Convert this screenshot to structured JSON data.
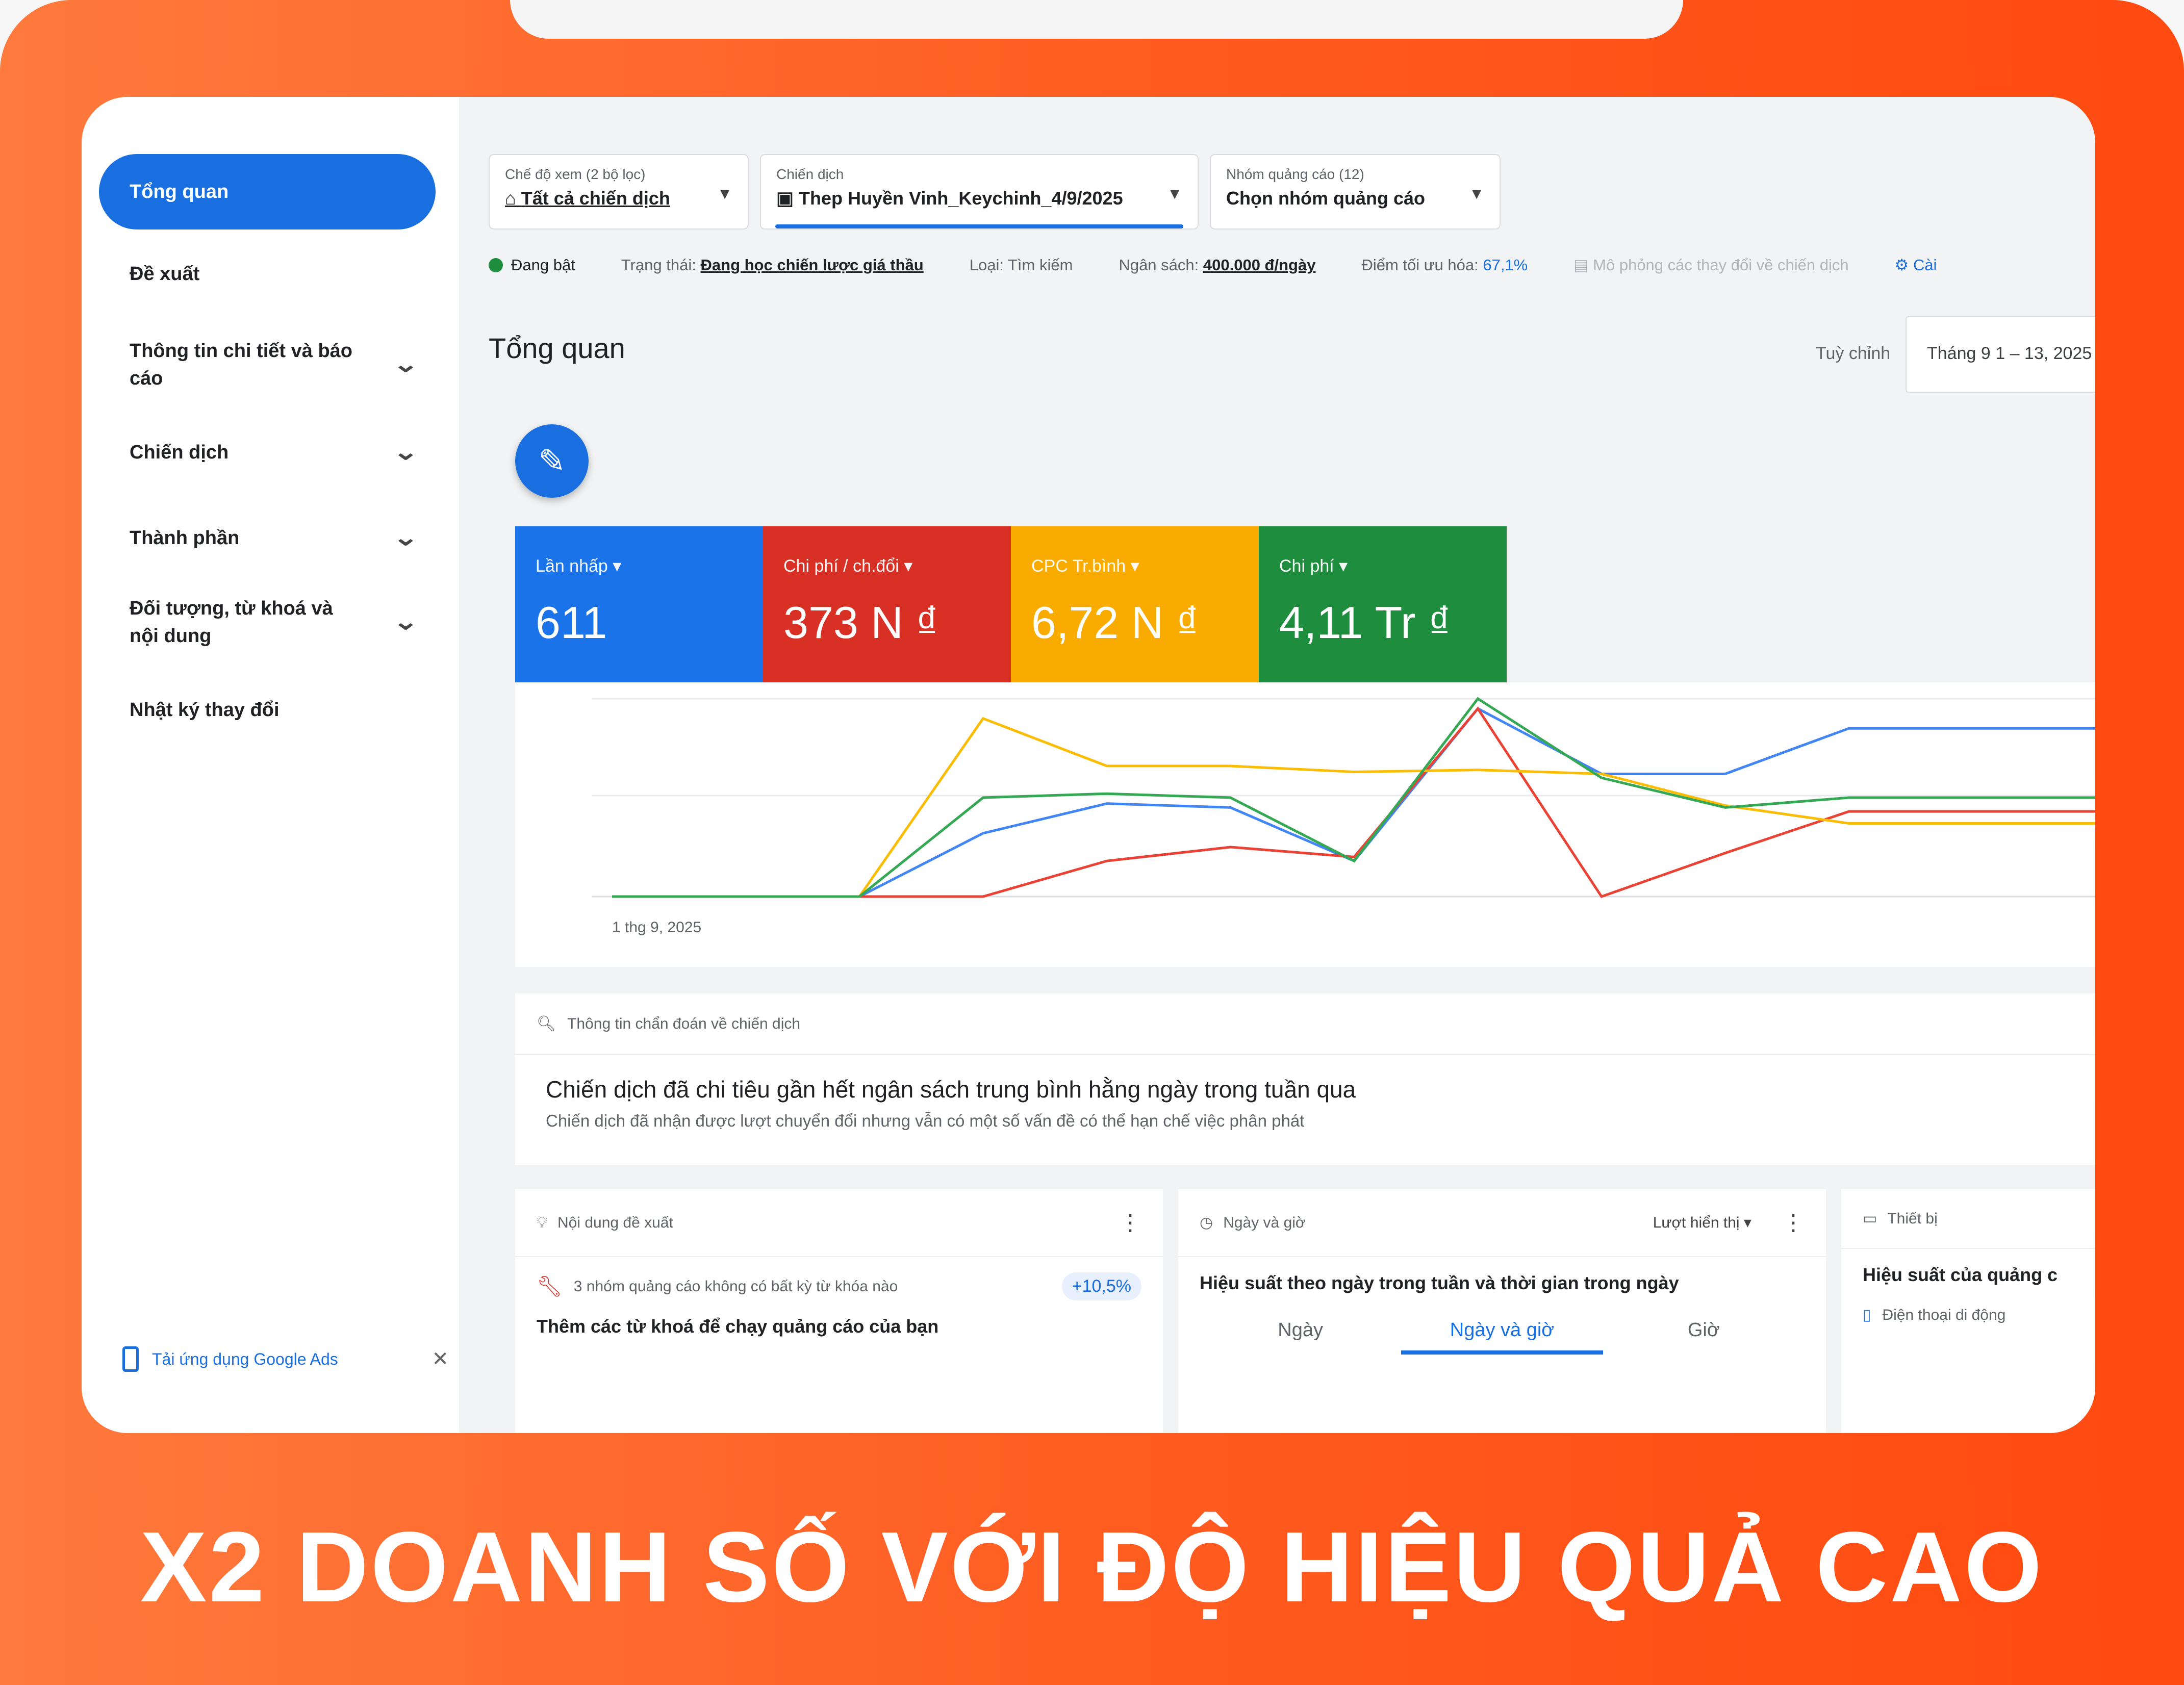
{
  "colors": {
    "primary": "#1a6fe0",
    "red": "#d93025",
    "yellow": "#f9ab00",
    "green": "#1e8e3e",
    "orange": "#ff5a1f"
  },
  "sidebar": {
    "items": [
      {
        "label": "Tổng quan",
        "active": true
      },
      {
        "label": "Đề xuất"
      },
      {
        "label": "Thông tin chi tiết và báo cáo",
        "expandable": true
      },
      {
        "label": "Chiến dịch",
        "expandable": true
      },
      {
        "label": "Thành phần",
        "expandable": true
      },
      {
        "label": "Đối tượng, từ khoá và nội dung",
        "expandable": true
      },
      {
        "label": "Nhật ký thay đổi"
      }
    ],
    "app_download": "Tải ứng dụng Google Ads"
  },
  "filters": {
    "view_mode": {
      "label": "Chế độ xem (2 bộ lọc)",
      "value": "Tất cả chiến dịch"
    },
    "campaign": {
      "label": "Chiến dịch",
      "value": "Thep Huyền Vinh_Keychinh_4/9/2025"
    },
    "ad_group": {
      "label": "Nhóm quảng cáo (12)",
      "value": "Chọn nhóm quảng cáo"
    }
  },
  "status_bar": {
    "status_on": "Đang bật",
    "state_label": "Trạng thái:",
    "state_value": "Đang học chiến lược giá thầu",
    "type": "Loại: Tìm kiếm",
    "budget_label": "Ngân sách:",
    "budget_value": "400.000 đ/ngày",
    "opt_label": "Điểm tối ưu hóa:",
    "opt_value": "67,1%",
    "simulate": "Mô phỏng các thay đổi về chiến dịch",
    "settings": "Cài"
  },
  "page": {
    "title": "Tổng quan",
    "customize": "Tuỳ chỉnh",
    "date_range": "Tháng 9 1 – 13, 2025"
  },
  "metrics": [
    {
      "label": "Lần nhấp",
      "value": "611",
      "color": "#1a73e8"
    },
    {
      "label": "Chi phí / ch.đổi",
      "value": "373 N ₫",
      "color": "#d93025"
    },
    {
      "label": "CPC Tr.bình",
      "value": "6,72 N ₫",
      "color": "#f9ab00"
    },
    {
      "label": "Chi phí",
      "value": "4,11 Tr ₫",
      "color": "#1e8e3e"
    }
  ],
  "chart_data": {
    "type": "line",
    "x_start_label": "1 thg 9, 2025",
    "x": [
      1,
      2,
      3,
      4,
      5,
      6,
      7,
      8,
      9,
      10,
      11,
      12,
      13
    ],
    "series": [
      {
        "color": "#4285f4",
        "values": [
          0,
          0,
          0,
          0.32,
          0.47,
          0.45,
          0.18,
          0.95,
          0.62,
          0.62,
          0.85,
          0.85,
          0.85
        ]
      },
      {
        "color": "#ea4335",
        "values": [
          0,
          0,
          0,
          0,
          0.18,
          0.25,
          0.2,
          0.95,
          0,
          0.22,
          0.43,
          0.43,
          0.43
        ]
      },
      {
        "color": "#fbbc04",
        "values": [
          0,
          0,
          0,
          0.9,
          0.66,
          0.66,
          0.63,
          0.64,
          0.62,
          0.46,
          0.37,
          0.37,
          0.37
        ]
      },
      {
        "color": "#34a853",
        "values": [
          0,
          0,
          0,
          0.5,
          0.52,
          0.5,
          0.18,
          1.0,
          0.6,
          0.45,
          0.5,
          0.5,
          0.5
        ]
      }
    ]
  },
  "diagnostics": {
    "header": "Thông tin chẩn đoán về chiến dịch",
    "title": "Chiến dịch đã chi tiêu gần hết ngân sách trung bình hằng ngày trong tuần qua",
    "subtitle": "Chiến dịch đã nhận được lượt chuyển đổi nhưng vẫn có một số vấn đề có thể hạn chế việc phân phát"
  },
  "cards": {
    "suggestions": {
      "header": "Nội dung đề xuất",
      "row": "3 nhóm quảng cáo không có bất kỳ từ khóa nào",
      "badge": "+10,5%",
      "action": "Thêm các từ khoá để chạy quảng cáo của bạn"
    },
    "day_time": {
      "header": "Ngày và giờ",
      "metric": "Lượt hiển thị",
      "title": "Hiệu suất theo ngày trong tuần và thời gian trong ngày",
      "tabs": [
        "Ngày",
        "Ngày và giờ",
        "Giờ"
      ]
    },
    "device": {
      "header": "Thiết bị",
      "title": "Hiệu suất của quảng c",
      "row": "Điện thoại di động"
    }
  },
  "headline": "X2 DOANH SỐ VỚI ĐỘ HIỆU QUẢ CAO"
}
